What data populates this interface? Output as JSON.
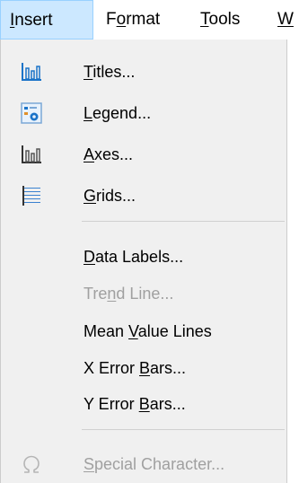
{
  "menubar": {
    "items": [
      {
        "pre": "",
        "key": "I",
        "post": "nsert"
      },
      {
        "pre": "F",
        "key": "o",
        "post": "rmat"
      },
      {
        "pre": "",
        "key": "T",
        "post": "ools"
      },
      {
        "pre": "",
        "key": "W",
        "post": ""
      }
    ]
  },
  "menu": {
    "items": [
      {
        "pre": "",
        "key": "T",
        "post": "itles...",
        "icon": "chart-titles-icon"
      },
      {
        "pre": "",
        "key": "L",
        "post": "egend...",
        "icon": "chart-legend-icon"
      },
      {
        "pre": "",
        "key": "A",
        "post": "xes...",
        "icon": "chart-axes-icon"
      },
      {
        "pre": "",
        "key": "G",
        "post": "rids...",
        "icon": "chart-grids-icon"
      },
      {
        "pre": "",
        "key": "D",
        "post": "ata Labels..."
      },
      {
        "pre": "Tre",
        "key": "n",
        "post": "d Line...",
        "disabled": true
      },
      {
        "pre": "Mean ",
        "key": "V",
        "post": "alue Lines"
      },
      {
        "pre": "X Error ",
        "key": "B",
        "post": "ars..."
      },
      {
        "pre": "Y Error ",
        "key": "B",
        "post": "ars..."
      },
      {
        "pre": "",
        "key": "S",
        "post": "pecial Character...",
        "icon": "omega-icon",
        "disabled": true
      }
    ]
  },
  "colors": {
    "highlight": "#cce8ff",
    "menu_background": "#f0f0f0",
    "disabled_text": "#a0a0a0",
    "icon_blue": "#1a73c8"
  }
}
